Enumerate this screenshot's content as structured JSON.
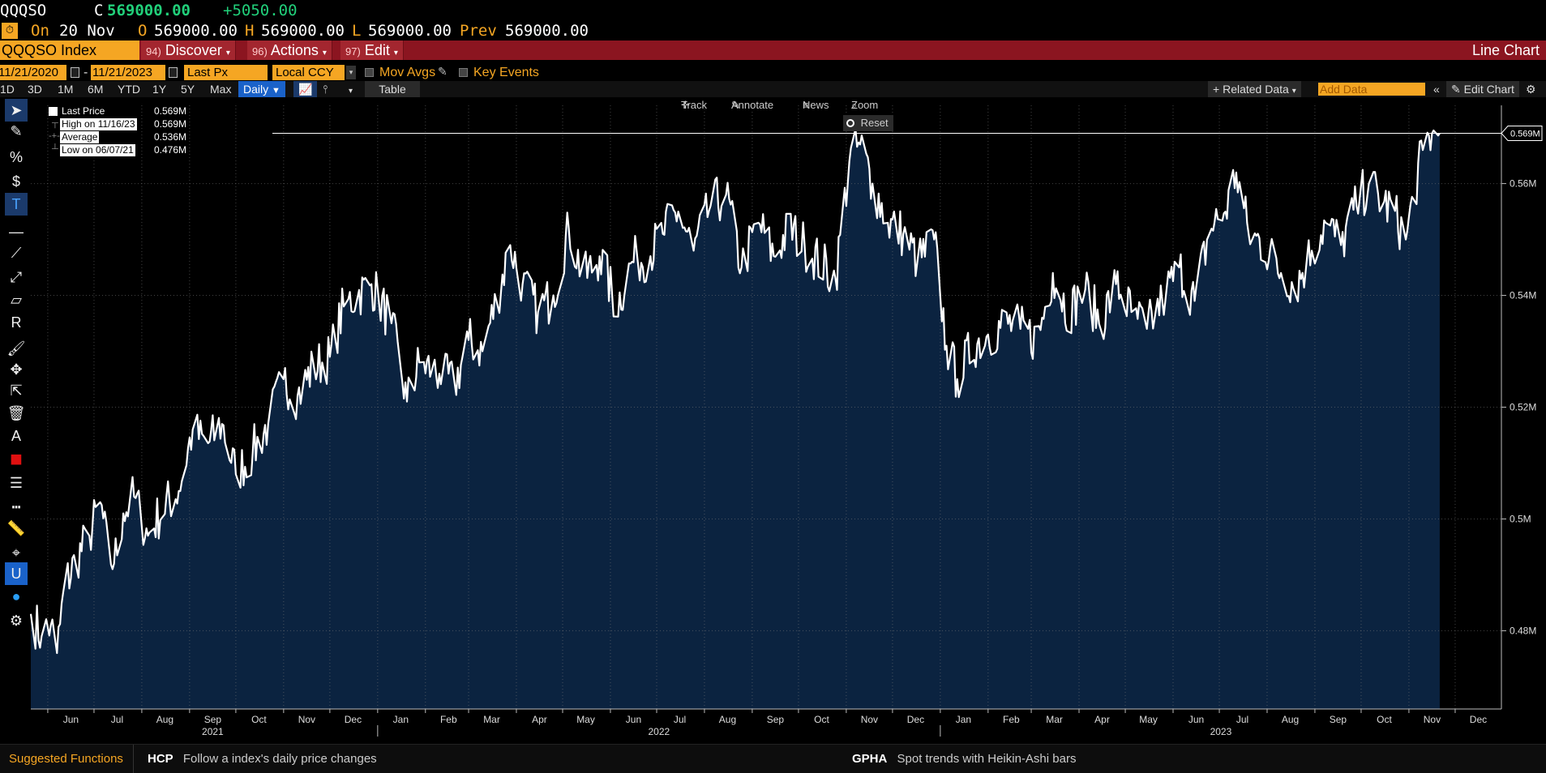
{
  "header": {
    "ticker": "QQQSO",
    "close_label": "C",
    "close_value": "569000.00",
    "change": "+5050.00",
    "on_label": "On",
    "on_date": "20 Nov",
    "open_label": "O",
    "open_value": "569000.00",
    "high_label": "H",
    "high_value": "569000.00",
    "low_label": "L",
    "low_value": "569000.00",
    "prev_label": "Prev",
    "prev_value": "569000.00"
  },
  "menubar": {
    "index_label": "QQQSO Index",
    "discover_num": "94)",
    "discover_label": "Discover",
    "actions_num": "96)",
    "actions_label": "Actions",
    "edit_num": "97)",
    "edit_label": "Edit",
    "title": "Line Chart"
  },
  "settings": {
    "start_date": "11/21/2020",
    "date_sep": "-",
    "end_date": "11/21/2023",
    "field": "Last Px",
    "currency": "Local CCY",
    "mov_avgs": "Mov Avgs",
    "key_events": "Key Events"
  },
  "periods": {
    "items": [
      "1D",
      "3D",
      "1M",
      "6M",
      "YTD",
      "1Y",
      "5Y",
      "Max"
    ],
    "frequency": "Daily",
    "table_label": "Table",
    "related_data": "Related Data",
    "add_data_placeholder": "Add Data",
    "edit_chart": "Edit Chart"
  },
  "chart_tools": {
    "track": "Track",
    "annotate": "Annotate",
    "news": "News",
    "zoom": "Zoom",
    "reset": "Reset"
  },
  "legend": {
    "last_price_label": "Last Price",
    "last_price_value": "0.569M",
    "high_label": "High on 11/16/23",
    "high_value": "0.569M",
    "average_label": "Average",
    "average_value": "0.536M",
    "low_label": "Low on 06/07/21",
    "low_value": "0.476M"
  },
  "chart_data": {
    "type": "area",
    "series": [
      {
        "name": "Last Price",
        "color": "#ffffff",
        "fill": "#0b2340"
      }
    ],
    "x_range": [
      "2021-05-21",
      "2023-12-31"
    ],
    "last_date": "2023-11-21",
    "ylim": [
      0.466,
      0.574
    ],
    "y_unit": "M",
    "y_ticks": [
      0.48,
      0.5,
      0.52,
      0.54,
      0.56
    ],
    "y_tick_labels": [
      "0.48M",
      "0.5M",
      "0.52M",
      "0.54M",
      "0.56M"
    ],
    "last_value_label": "0.569M",
    "last_value": 0.569,
    "months": [
      "Jun",
      "Jul",
      "Aug",
      "Sep",
      "Oct",
      "Nov",
      "Dec",
      "Jan",
      "Feb",
      "Mar",
      "Apr",
      "May",
      "Jun",
      "Jul",
      "Aug",
      "Sep",
      "Oct",
      "Nov",
      "Dec",
      "Jan",
      "Feb",
      "Mar",
      "Apr",
      "May",
      "Jun",
      "Jul",
      "Aug",
      "Sep",
      "Oct",
      "Nov",
      "Dec"
    ],
    "years": [
      "2021",
      "2022",
      "2023"
    ],
    "anchors": [
      [
        "2021-05-21",
        0.483
      ],
      [
        "2021-05-28",
        0.479
      ],
      [
        "2021-06-03",
        0.481
      ],
      [
        "2021-06-07",
        0.476
      ],
      [
        "2021-06-12",
        0.488
      ],
      [
        "2021-06-20",
        0.493
      ],
      [
        "2021-06-28",
        0.497
      ],
      [
        "2021-07-05",
        0.503
      ],
      [
        "2021-07-10",
        0.494
      ],
      [
        "2021-07-14",
        0.492
      ],
      [
        "2021-07-20",
        0.501
      ],
      [
        "2021-07-27",
        0.504
      ],
      [
        "2021-08-05",
        0.497
      ],
      [
        "2021-08-15",
        0.502
      ],
      [
        "2021-08-25",
        0.505
      ],
      [
        "2021-09-03",
        0.516
      ],
      [
        "2021-09-12",
        0.513
      ],
      [
        "2021-09-22",
        0.517
      ],
      [
        "2021-10-01",
        0.508
      ],
      [
        "2021-10-12",
        0.512
      ],
      [
        "2021-10-22",
        0.517
      ],
      [
        "2021-11-01",
        0.525
      ],
      [
        "2021-11-10",
        0.522
      ],
      [
        "2021-11-20",
        0.527
      ],
      [
        "2021-12-01",
        0.529
      ],
      [
        "2021-12-10",
        0.538
      ],
      [
        "2021-12-18",
        0.54
      ],
      [
        "2021-12-28",
        0.542
      ],
      [
        "2022-01-10",
        0.535
      ],
      [
        "2022-01-20",
        0.521
      ],
      [
        "2022-01-28",
        0.528
      ],
      [
        "2022-02-10",
        0.526
      ],
      [
        "2022-02-20",
        0.524
      ],
      [
        "2022-03-01",
        0.532
      ],
      [
        "2022-03-10",
        0.53
      ],
      [
        "2022-03-20",
        0.54
      ],
      [
        "2022-03-28",
        0.549
      ],
      [
        "2022-04-05",
        0.542
      ],
      [
        "2022-04-15",
        0.537
      ],
      [
        "2022-04-25",
        0.54
      ],
      [
        "2022-05-05",
        0.552
      ],
      [
        "2022-05-15",
        0.543
      ],
      [
        "2022-05-25",
        0.547
      ],
      [
        "2022-06-05",
        0.538
      ],
      [
        "2022-06-15",
        0.546
      ],
      [
        "2022-06-25",
        0.547
      ],
      [
        "2022-07-05",
        0.551
      ],
      [
        "2022-07-15",
        0.555
      ],
      [
        "2022-07-25",
        0.548
      ],
      [
        "2022-08-05",
        0.556
      ],
      [
        "2022-08-15",
        0.558
      ],
      [
        "2022-08-25",
        0.545
      ],
      [
        "2022-09-05",
        0.553
      ],
      [
        "2022-09-15",
        0.547
      ],
      [
        "2022-09-25",
        0.552
      ],
      [
        "2022-10-05",
        0.549
      ],
      [
        "2022-10-15",
        0.546
      ],
      [
        "2022-10-25",
        0.543
      ],
      [
        "2022-11-03",
        0.564
      ],
      [
        "2022-11-10",
        0.567
      ],
      [
        "2022-11-18",
        0.56
      ],
      [
        "2022-11-28",
        0.553
      ],
      [
        "2022-12-08",
        0.551
      ],
      [
        "2022-12-18",
        0.546
      ],
      [
        "2022-12-28",
        0.55
      ],
      [
        "2023-01-05",
        0.531
      ],
      [
        "2023-01-12",
        0.525
      ],
      [
        "2023-01-22",
        0.531
      ],
      [
        "2023-02-01",
        0.533
      ],
      [
        "2023-02-12",
        0.535
      ],
      [
        "2023-02-22",
        0.534
      ],
      [
        "2023-03-05",
        0.532
      ],
      [
        "2023-03-15",
        0.544
      ],
      [
        "2023-03-25",
        0.537
      ],
      [
        "2023-04-05",
        0.541
      ],
      [
        "2023-04-15",
        0.535
      ],
      [
        "2023-04-25",
        0.542
      ],
      [
        "2023-05-05",
        0.537
      ],
      [
        "2023-05-15",
        0.534
      ],
      [
        "2023-05-25",
        0.539
      ],
      [
        "2023-06-05",
        0.545
      ],
      [
        "2023-06-15",
        0.539
      ],
      [
        "2023-06-25",
        0.552
      ],
      [
        "2023-07-05",
        0.555
      ],
      [
        "2023-07-12",
        0.562
      ],
      [
        "2023-07-20",
        0.551
      ],
      [
        "2023-07-30",
        0.549
      ],
      [
        "2023-08-10",
        0.544
      ],
      [
        "2023-08-20",
        0.542
      ],
      [
        "2023-08-30",
        0.548
      ],
      [
        "2023-09-08",
        0.553
      ],
      [
        "2023-09-18",
        0.549
      ],
      [
        "2023-09-28",
        0.556
      ],
      [
        "2023-10-06",
        0.56
      ],
      [
        "2023-10-14",
        0.557
      ],
      [
        "2023-10-22",
        0.555
      ],
      [
        "2023-10-30",
        0.55
      ],
      [
        "2023-11-05",
        0.559
      ],
      [
        "2023-11-10",
        0.566
      ],
      [
        "2023-11-16",
        0.569
      ],
      [
        "2023-11-19",
        0.567
      ],
      [
        "2023-11-21",
        0.569
      ]
    ]
  },
  "tools": [
    "pointer-icon",
    "pen-icon",
    "percent-icon",
    "dollar-icon",
    "text-icon",
    "hline-icon",
    "trendline-icon",
    "ray-icon",
    "channel-icon",
    "regression-icon",
    "brush-icon",
    "move-icon",
    "pointer-plus-icon",
    "trash-icon",
    "font-icon",
    "color-swatch-icon",
    "line-weight-icon",
    "line-style-icon",
    "ruler-icon",
    "crosshair-icon",
    "magnet-icon",
    "palette-icon",
    "gear-icon"
  ],
  "bottom": {
    "suggested_label": "Suggested Functions",
    "hcp_code": "HCP",
    "hcp_desc": "Follow a index's daily price changes",
    "gpha_code": "GPHA",
    "gpha_desc": "Spot trends with Heikin-Ashi bars"
  },
  "colors": {
    "accent": "#f5a623",
    "menubar": "#8b1520",
    "positive": "#21d07a",
    "area_fill": "#0b2340"
  }
}
